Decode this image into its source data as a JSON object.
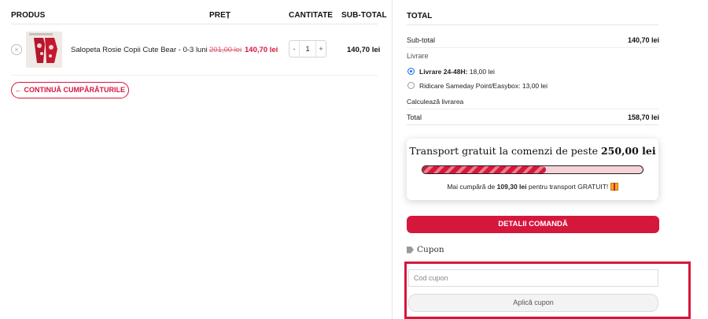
{
  "cart": {
    "headers": {
      "product": "PRODUS",
      "price": "PREȚ",
      "quantity": "CANTITATE",
      "subtotal": "SUB-TOTAL"
    },
    "item": {
      "name": "Salopeta Rosie Copii Cute Bear - 0-3 luni",
      "old_price": "201,00 lei",
      "price": "140,70 lei",
      "quantity": "1",
      "minus": "-",
      "plus": "+",
      "subtotal": "140,70 lei",
      "remove_symbol": "×"
    },
    "continue_label": "← CONTINUĂ CUMPĂRĂTURILE"
  },
  "totals": {
    "title": "TOTAL",
    "subtotal_label": "Sub-total",
    "subtotal_value": "140,70 lei",
    "shipping_label": "Livrare",
    "shipping_options": [
      {
        "name": "Livrare 24-48H:",
        "price": "18,00 lei",
        "selected": true
      },
      {
        "name": "Ridicare Sameday Point/Easybox:",
        "price": "13,00 lei",
        "selected": false
      }
    ],
    "calculate_label": "Calculează livrarea",
    "total_label": "Total",
    "total_value": "158,70 lei"
  },
  "free_shipping": {
    "headline_prefix": "Transport gratuit la comenzi de peste",
    "threshold": "250,00 lei",
    "progress_percent": 56,
    "remaining_prefix": "Mai cumpără de",
    "remaining_amount": "109,30 lei",
    "remaining_suffix": "pentru transport GRATUIT!"
  },
  "order_details_label": "DETALII COMANDĂ",
  "coupon": {
    "title": "Cupon",
    "placeholder": "Cod cupon",
    "apply_label": "Aplică cupon"
  },
  "colors": {
    "accent": "#d6173c",
    "highlight": "#d6173c"
  }
}
